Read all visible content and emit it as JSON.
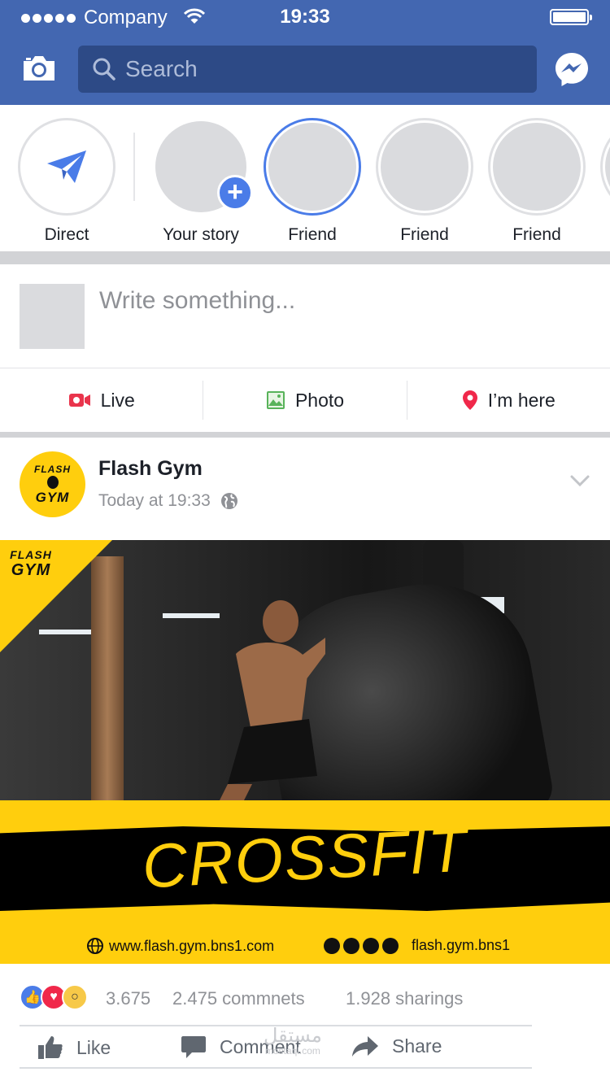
{
  "status_bar": {
    "carrier": "Company",
    "time": "19:33"
  },
  "header": {
    "search_placeholder": "Search"
  },
  "stories": [
    {
      "label": "Direct"
    },
    {
      "label": "Your story"
    },
    {
      "label": "Friend"
    },
    {
      "label": "Friend"
    },
    {
      "label": "Friend"
    }
  ],
  "composer": {
    "placeholder": "Write something..."
  },
  "composer_actions": [
    {
      "label": "Live",
      "color": "#e9344c"
    },
    {
      "label": "Photo",
      "color": "#58b35a"
    },
    {
      "label": "I’m here",
      "color": "#f0284a"
    }
  ],
  "post": {
    "author": "Flash Gym",
    "time": "Today at 19:33",
    "logo_text_top": "FLASH",
    "logo_text_bottom": "GYM",
    "image": {
      "headline": "CROSSFIT",
      "website": "www.flash.gym.bns1.com",
      "handle": "flash.gym.bns1",
      "accent": "#ffce0d"
    },
    "reactions_count": "3.675",
    "comments_count": "2.475 commnets",
    "shares_count": "1.928 sharings"
  },
  "footer_actions": {
    "like": "Like",
    "comment": "Comment",
    "share": "Share"
  },
  "watermark": {
    "arabic": "مستقل",
    "latin": "mostaql.com"
  },
  "colors": {
    "brand": "#4367b1",
    "accent_blue": "#4a7ce8"
  }
}
